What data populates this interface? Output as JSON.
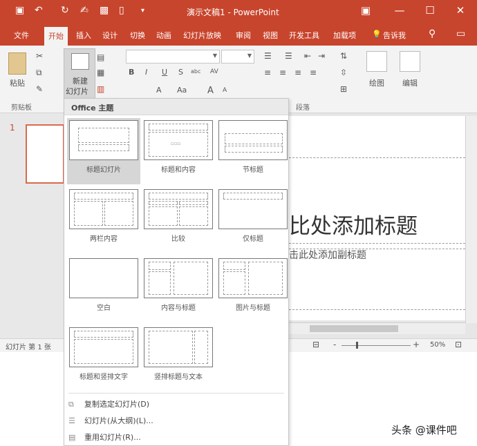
{
  "window": {
    "title": "演示文稿1 - PowerPoint",
    "qat": {
      "save_icon": "▣",
      "undo_icon": "↶",
      "redo_icon": "↻",
      "touch_icon": "✍",
      "present_icon": "▩",
      "new_icon": "▯",
      "more_icon": "▾"
    },
    "controls": {
      "ribbon_opts": "▣",
      "minimize": "—",
      "maximize": "☐",
      "close": "✕"
    }
  },
  "tabs": [
    {
      "label": "文件"
    },
    {
      "label": "开始"
    },
    {
      "label": "插入"
    },
    {
      "label": "设计"
    },
    {
      "label": "切换"
    },
    {
      "label": "动画"
    },
    {
      "label": "幻灯片放映"
    },
    {
      "label": "审阅"
    },
    {
      "label": "视图"
    },
    {
      "label": "开发工具"
    },
    {
      "label": "加载项"
    },
    {
      "label": "告诉我"
    }
  ],
  "tell_me_icon": "💡",
  "user_icon": "⚲",
  "comment_icon": "▭",
  "ribbon": {
    "paste_label": "粘贴",
    "new_slide_label_1": "新建",
    "new_slide_label_2": "幻灯片",
    "clipboard_group": "剪贴板",
    "paragraph_group": "段落",
    "draw_label": "绘图",
    "edit_label": "编辑",
    "font_buttons": [
      "B",
      "I",
      "U",
      "S",
      "abc",
      "AV",
      "A",
      "Aa",
      "A",
      "A"
    ]
  },
  "slide_panel": {
    "slide_number": "1"
  },
  "slide": {
    "title": "比处添加标题",
    "subtitle": "击此处添加副标题"
  },
  "status": {
    "slide_info": "幻灯片 第 1 张",
    "zoom": "50%",
    "minus": "-",
    "plus": "+"
  },
  "dropdown": {
    "header": "Office 主题",
    "layouts": [
      {
        "label": "标题幻灯片",
        "selected": true
      },
      {
        "label": "标题和内容",
        "selected": false
      },
      {
        "label": "节标题",
        "selected": false
      },
      {
        "label": "两栏内容",
        "selected": false
      },
      {
        "label": "比较",
        "selected": false
      },
      {
        "label": "仅标题",
        "selected": false
      },
      {
        "label": "空白",
        "selected": false
      },
      {
        "label": "内容与标题",
        "selected": false
      },
      {
        "label": "图片与标题",
        "selected": false
      },
      {
        "label": "标题和竖排文字",
        "selected": false
      },
      {
        "label": "竖排标题与文本",
        "selected": false
      }
    ],
    "commands": [
      {
        "label": "复制选定幻灯片(D)",
        "icon": "⧉"
      },
      {
        "label": "幻灯片(从大纲)(L)...",
        "icon": "☰"
      },
      {
        "label": "重用幻灯片(R)...",
        "icon": "▤"
      }
    ]
  },
  "watermark": "头条 @课件吧"
}
